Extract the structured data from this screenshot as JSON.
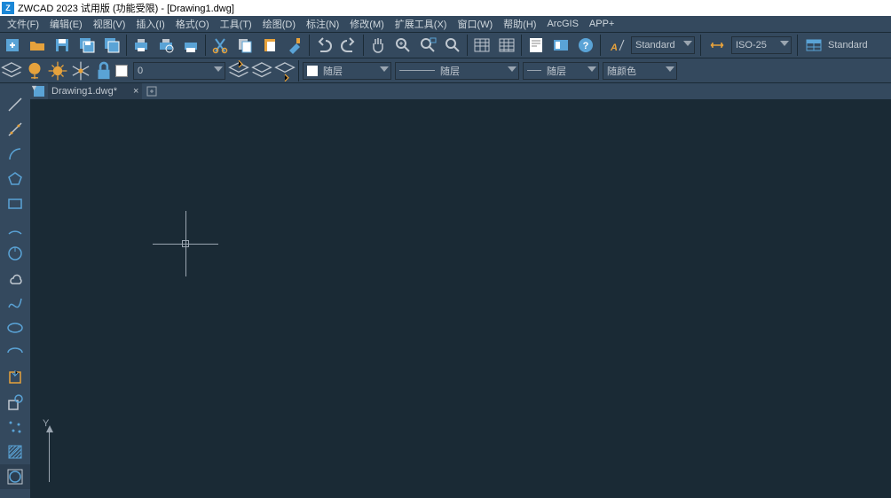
{
  "title": "ZWCAD 2023 试用版 (功能受限) - [Drawing1.dwg]",
  "menus": {
    "file": "文件(F)",
    "edit": "编辑(E)",
    "view": "视图(V)",
    "insert": "插入(I)",
    "format": "格式(O)",
    "tools": "工具(T)",
    "draw": "绘图(D)",
    "annotate": "标注(N)",
    "modify": "修改(M)",
    "ext": "扩展工具(X)",
    "window": "窗口(W)",
    "help": "帮助(H)",
    "arcgis": "ArcGIS",
    "app": "APP+"
  },
  "layers": {
    "zero": "0",
    "bylayer1": "随层",
    "bylayer2": "随层",
    "bylayer3": "随层",
    "bycolor": "随颜色"
  },
  "styles": {
    "text": "Standard",
    "dim": "ISO-25",
    "table": "Standard"
  },
  "tabs": {
    "doc": "Drawing1.dwg*"
  },
  "ucs": {
    "y": "Y"
  }
}
